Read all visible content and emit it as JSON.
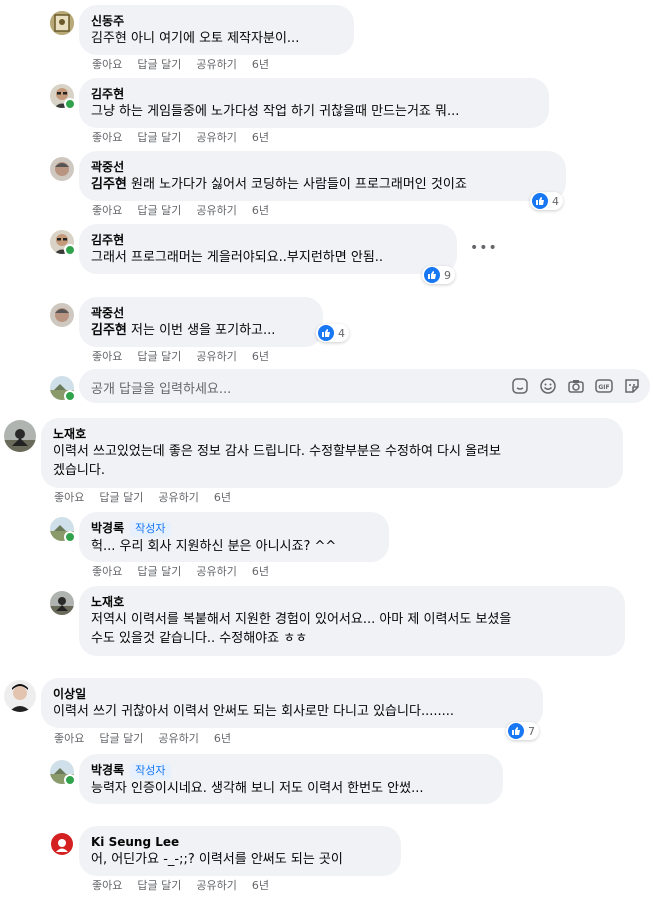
{
  "actions": {
    "like": "좋아요",
    "reply": "답글 달기",
    "share": "공유하기"
  },
  "comments": [
    {
      "name": "신동주",
      "text": "김주현 아니 여기에 오토 제작자분이...",
      "time": "6년"
    },
    {
      "name": "김주현",
      "text": "그냥 하는 게임들중에 노가다성 작업 하기 귀찮을때 만드는거죠 뭐...",
      "time": "6년"
    },
    {
      "name": "곽중선",
      "mention": "김주현",
      "text": " 원래 노가다가 싫어서 코딩하는 사람들이 프로그래머인 것이죠",
      "time": "6년",
      "reactions": "4"
    },
    {
      "name": "김주현",
      "text": "그래서 프로그래머는 게을러야되요..부지런하면 안됨..",
      "time": "6년",
      "reactions": "9"
    },
    {
      "name": "곽중선",
      "mention": "김주현",
      "text": " 저는 이번 생을 포기하고...",
      "time": "6년",
      "reactions": "4"
    },
    {
      "name": "노재호",
      "text1": "이력서 쓰고있었는데 좋은 정보 감사 드립니다. 수정할부분은 수정하여 다시 올려보",
      "text2": "겠습니다.",
      "time": "6년"
    },
    {
      "name": "박경록",
      "badge": "작성자",
      "text": "헉... 우리 회사 지원하신 분은 아니시죠? ^^",
      "time": "6년"
    },
    {
      "name": "노재호",
      "text1": "저역시 이력서를 복붙해서 지원한 경험이 있어서요... 아마 제 이력서도 보셨을",
      "text2": "수도 있을것 같습니다.. 수정해야죠 ㅎㅎ"
    },
    {
      "name": "이상일",
      "text": "이력서 쓰기 귀찮아서 이력서 안써도 되는 회사로만 다니고 있습니다........",
      "time": "6년",
      "reactions": "7"
    },
    {
      "name": "박경록",
      "badge": "작성자",
      "text": "능력자 인증이시네요. 생각해 보니 저도 이력서 한번도 안썼...",
      "time": "6년"
    },
    {
      "name": "Ki Seung Lee",
      "text": "어, 어딘가요 -_-;;? 이력서를 안써도 되는 곳이",
      "time": "6년"
    }
  ],
  "reply_input": {
    "placeholder": "공개 답글을 입력하세요..."
  },
  "icons": [
    "sticker-icon",
    "emoji-icon",
    "camera-icon",
    "gif-icon",
    "sticker2-icon"
  ],
  "colors": {
    "bubble": "#f0f2f5",
    "accent": "#1877f2",
    "online": "#31a24c",
    "meta": "#65676b"
  }
}
